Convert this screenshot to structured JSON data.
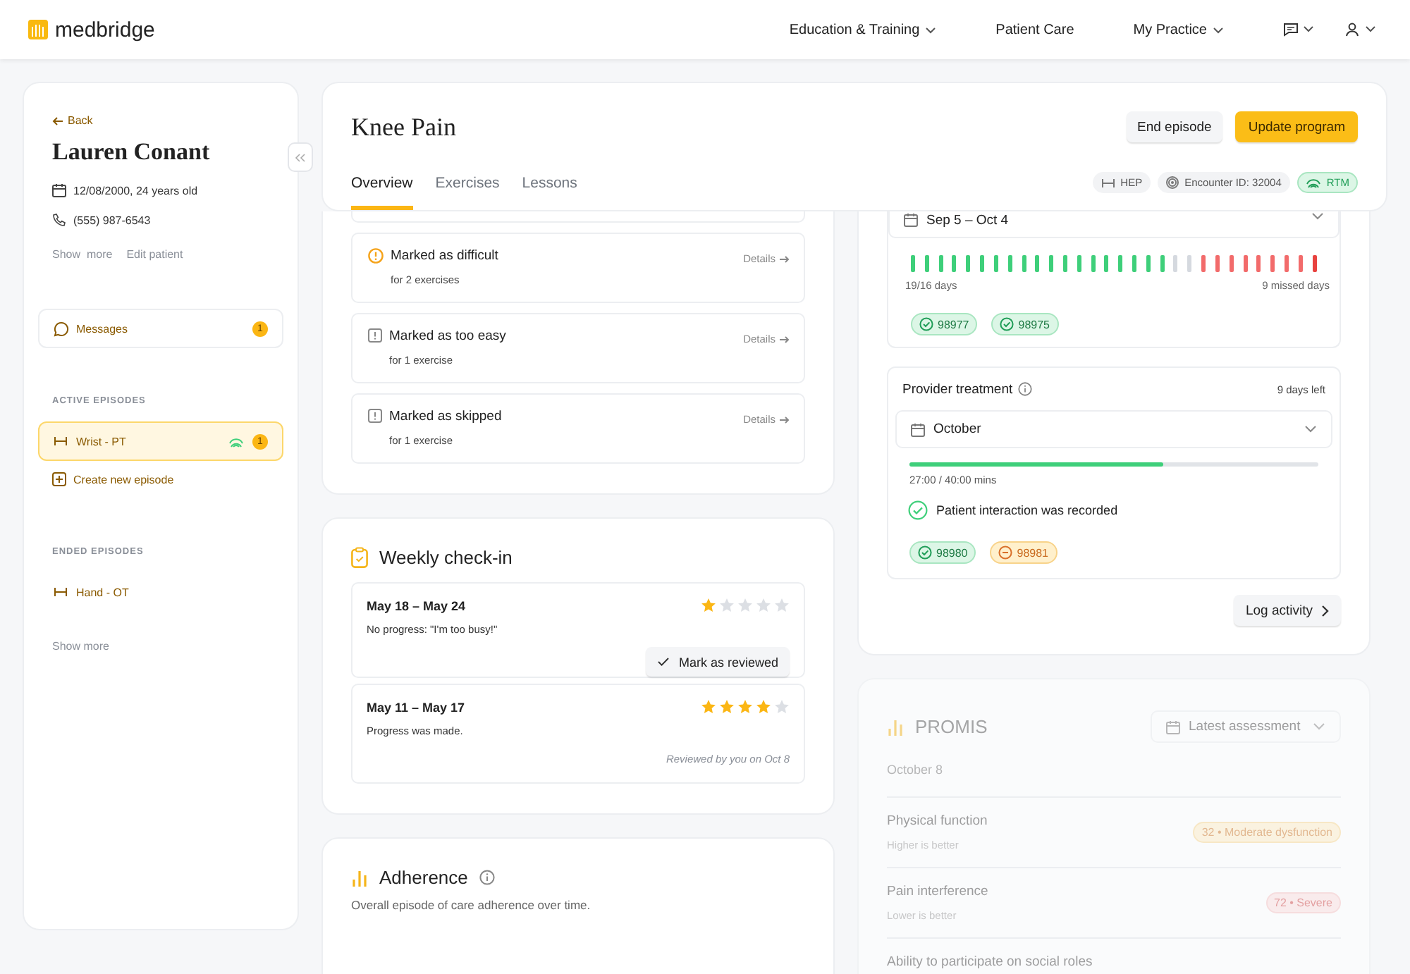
{
  "nav": {
    "brand": "medbridge",
    "items": [
      {
        "label": "Education & Training",
        "dropdown": true
      },
      {
        "label": "Patient Care",
        "dropdown": false
      },
      {
        "label": "My Practice",
        "dropdown": true
      }
    ]
  },
  "sidebar": {
    "back": "Back",
    "name": "Lauren Conant",
    "dob": "12/08/2000, 24 years old",
    "phone": "(555) 987-6543",
    "links": [
      "Show  more",
      "Edit patient"
    ],
    "messages": {
      "label": "Messages",
      "badge": "1"
    },
    "active_heading": "ACTIVE EPISODES",
    "active": [
      {
        "label": "Wrist - PT",
        "selected": true,
        "rtm": true,
        "badge": "1"
      }
    ],
    "create": "Create new episode",
    "ended_heading": "ENDED EPISODES",
    "ended": [
      {
        "label": "Hand - OT",
        "selected": false,
        "rtm": false
      }
    ],
    "show_more": "Show more"
  },
  "episode": {
    "title": "Knee Pain",
    "buttons": [
      {
        "label": "End episode",
        "kind": "secondary"
      },
      {
        "label": "Update program",
        "kind": "primary"
      }
    ],
    "tabs": [
      {
        "label": "Overview",
        "selected": true
      },
      {
        "label": "Exercises",
        "selected": false
      },
      {
        "label": "Lessons",
        "selected": false
      }
    ],
    "chips": [
      {
        "label": "HEP",
        "kind": "hep"
      },
      {
        "label": "Encounter ID: 32004",
        "kind": "encounter"
      },
      {
        "label": "RTM",
        "kind": "rtm"
      }
    ]
  },
  "alerts": [
    {
      "title": "Marked as difficult",
      "detail": "for 2 exercises",
      "kind": "warning",
      "link": "Details"
    },
    {
      "title": "Marked as too easy",
      "detail": "for 1 exercise",
      "kind": "info",
      "link": "Details"
    },
    {
      "title": "Marked as skipped",
      "detail": "for 1 exercise",
      "kind": "info",
      "link": "Details"
    }
  ],
  "checkin": {
    "title": "Weekly check-in",
    "entries": [
      {
        "dates": "May 18 – May 24",
        "note": "No progress: \"I'm too busy!\"",
        "stars": 1,
        "action": "Mark as reviewed"
      },
      {
        "dates": "May 11 – May 17",
        "note": "Progress was made.",
        "stars": 4,
        "reviewed": "Reviewed by you on Oct 8"
      }
    ]
  },
  "adherence": {
    "title": "Adherence",
    "subtitle": "Overall episode of care adherence over time."
  },
  "rtm": {
    "period": "Sep 5 – Oct 4",
    "days": [
      {
        "color": "#3ecf7a"
      },
      {
        "color": "#3ecf7a"
      },
      {
        "color": "#3ecf7a"
      },
      {
        "color": "#3ecf7a"
      },
      {
        "color": "#3ecf7a"
      },
      {
        "color": "#3ecf7a"
      },
      {
        "color": "#3ecf7a"
      },
      {
        "color": "#3ecf7a"
      },
      {
        "color": "#3ecf7a"
      },
      {
        "color": "#3ecf7a"
      },
      {
        "color": "#3ecf7a"
      },
      {
        "color": "#3ecf7a"
      },
      {
        "color": "#3ecf7a"
      },
      {
        "color": "#3ecf7a"
      },
      {
        "color": "#3ecf7a"
      },
      {
        "color": "#3ecf7a"
      },
      {
        "color": "#3ecf7a"
      },
      {
        "color": "#3ecf7a"
      },
      {
        "color": "#3ecf7a"
      },
      {
        "color": "#d5d9df"
      },
      {
        "color": "#d5d9df"
      },
      {
        "color": "#f26b6b"
      },
      {
        "color": "#f26b6b"
      },
      {
        "color": "#f26b6b"
      },
      {
        "color": "#f26b6b"
      },
      {
        "color": "#f26b6b"
      },
      {
        "color": "#f26b6b"
      },
      {
        "color": "#f26b6b"
      },
      {
        "color": "#f26b6b"
      },
      {
        "color": "#e8423f"
      }
    ],
    "days_label": "19/16 days",
    "missed_label": "9 missed days",
    "codes": [
      {
        "code": "98977",
        "kind": "done"
      },
      {
        "code": "98975",
        "kind": "done"
      }
    ],
    "treatment": {
      "title": "Provider treatment",
      "remaining": "9 days left",
      "month": "October",
      "level": 0.62,
      "reading": "27:00 / 40:00 mins",
      "note": "Patient interaction was recorded",
      "codes": [
        {
          "code": "98980",
          "kind": "done"
        },
        {
          "code": "98981",
          "kind": "partial"
        }
      ]
    },
    "log": "Log activity"
  },
  "promis": {
    "title": "PROMIS",
    "disabled": true,
    "select": "Latest assessment",
    "date": "October 8",
    "rows": [
      {
        "name": "Physical function",
        "hint": "Higher is better",
        "score": "32 • Moderate dysfunction",
        "kind": "moderate"
      },
      {
        "name": "Pain interference",
        "hint": "Lower is better",
        "score": "72 • Severe",
        "kind": "severe"
      },
      {
        "name": "Ability to participate on social roles"
      }
    ]
  }
}
